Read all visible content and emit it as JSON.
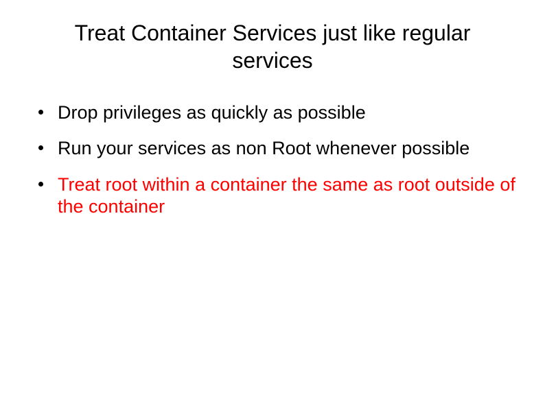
{
  "title": "Treat Container Services just like regular services",
  "bullets": [
    {
      "text": "Drop privileges as quickly as possible",
      "color": "black"
    },
    {
      "text": "Run your services as non Root whenever possible",
      "color": "black"
    },
    {
      "text": "Treat root within a container the same as root outside of the container",
      "color": "red"
    }
  ]
}
